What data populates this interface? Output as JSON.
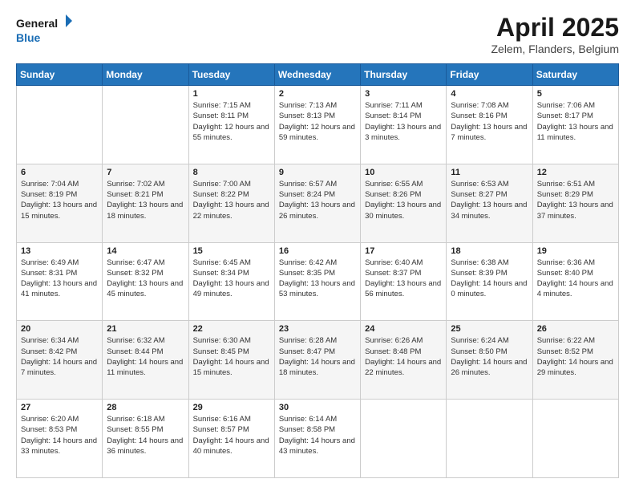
{
  "logo": {
    "line1": "General",
    "line2": "Blue"
  },
  "title": "April 2025",
  "subtitle": "Zelem, Flanders, Belgium",
  "days_of_week": [
    "Sunday",
    "Monday",
    "Tuesday",
    "Wednesday",
    "Thursday",
    "Friday",
    "Saturday"
  ],
  "weeks": [
    [
      {
        "day": "",
        "info": ""
      },
      {
        "day": "",
        "info": ""
      },
      {
        "day": "1",
        "info": "Sunrise: 7:15 AM\nSunset: 8:11 PM\nDaylight: 12 hours and 55 minutes."
      },
      {
        "day": "2",
        "info": "Sunrise: 7:13 AM\nSunset: 8:13 PM\nDaylight: 12 hours and 59 minutes."
      },
      {
        "day": "3",
        "info": "Sunrise: 7:11 AM\nSunset: 8:14 PM\nDaylight: 13 hours and 3 minutes."
      },
      {
        "day": "4",
        "info": "Sunrise: 7:08 AM\nSunset: 8:16 PM\nDaylight: 13 hours and 7 minutes."
      },
      {
        "day": "5",
        "info": "Sunrise: 7:06 AM\nSunset: 8:17 PM\nDaylight: 13 hours and 11 minutes."
      }
    ],
    [
      {
        "day": "6",
        "info": "Sunrise: 7:04 AM\nSunset: 8:19 PM\nDaylight: 13 hours and 15 minutes."
      },
      {
        "day": "7",
        "info": "Sunrise: 7:02 AM\nSunset: 8:21 PM\nDaylight: 13 hours and 18 minutes."
      },
      {
        "day": "8",
        "info": "Sunrise: 7:00 AM\nSunset: 8:22 PM\nDaylight: 13 hours and 22 minutes."
      },
      {
        "day": "9",
        "info": "Sunrise: 6:57 AM\nSunset: 8:24 PM\nDaylight: 13 hours and 26 minutes."
      },
      {
        "day": "10",
        "info": "Sunrise: 6:55 AM\nSunset: 8:26 PM\nDaylight: 13 hours and 30 minutes."
      },
      {
        "day": "11",
        "info": "Sunrise: 6:53 AM\nSunset: 8:27 PM\nDaylight: 13 hours and 34 minutes."
      },
      {
        "day": "12",
        "info": "Sunrise: 6:51 AM\nSunset: 8:29 PM\nDaylight: 13 hours and 37 minutes."
      }
    ],
    [
      {
        "day": "13",
        "info": "Sunrise: 6:49 AM\nSunset: 8:31 PM\nDaylight: 13 hours and 41 minutes."
      },
      {
        "day": "14",
        "info": "Sunrise: 6:47 AM\nSunset: 8:32 PM\nDaylight: 13 hours and 45 minutes."
      },
      {
        "day": "15",
        "info": "Sunrise: 6:45 AM\nSunset: 8:34 PM\nDaylight: 13 hours and 49 minutes."
      },
      {
        "day": "16",
        "info": "Sunrise: 6:42 AM\nSunset: 8:35 PM\nDaylight: 13 hours and 53 minutes."
      },
      {
        "day": "17",
        "info": "Sunrise: 6:40 AM\nSunset: 8:37 PM\nDaylight: 13 hours and 56 minutes."
      },
      {
        "day": "18",
        "info": "Sunrise: 6:38 AM\nSunset: 8:39 PM\nDaylight: 14 hours and 0 minutes."
      },
      {
        "day": "19",
        "info": "Sunrise: 6:36 AM\nSunset: 8:40 PM\nDaylight: 14 hours and 4 minutes."
      }
    ],
    [
      {
        "day": "20",
        "info": "Sunrise: 6:34 AM\nSunset: 8:42 PM\nDaylight: 14 hours and 7 minutes."
      },
      {
        "day": "21",
        "info": "Sunrise: 6:32 AM\nSunset: 8:44 PM\nDaylight: 14 hours and 11 minutes."
      },
      {
        "day": "22",
        "info": "Sunrise: 6:30 AM\nSunset: 8:45 PM\nDaylight: 14 hours and 15 minutes."
      },
      {
        "day": "23",
        "info": "Sunrise: 6:28 AM\nSunset: 8:47 PM\nDaylight: 14 hours and 18 minutes."
      },
      {
        "day": "24",
        "info": "Sunrise: 6:26 AM\nSunset: 8:48 PM\nDaylight: 14 hours and 22 minutes."
      },
      {
        "day": "25",
        "info": "Sunrise: 6:24 AM\nSunset: 8:50 PM\nDaylight: 14 hours and 26 minutes."
      },
      {
        "day": "26",
        "info": "Sunrise: 6:22 AM\nSunset: 8:52 PM\nDaylight: 14 hours and 29 minutes."
      }
    ],
    [
      {
        "day": "27",
        "info": "Sunrise: 6:20 AM\nSunset: 8:53 PM\nDaylight: 14 hours and 33 minutes."
      },
      {
        "day": "28",
        "info": "Sunrise: 6:18 AM\nSunset: 8:55 PM\nDaylight: 14 hours and 36 minutes."
      },
      {
        "day": "29",
        "info": "Sunrise: 6:16 AM\nSunset: 8:57 PM\nDaylight: 14 hours and 40 minutes."
      },
      {
        "day": "30",
        "info": "Sunrise: 6:14 AM\nSunset: 8:58 PM\nDaylight: 14 hours and 43 minutes."
      },
      {
        "day": "",
        "info": ""
      },
      {
        "day": "",
        "info": ""
      },
      {
        "day": "",
        "info": ""
      }
    ]
  ]
}
